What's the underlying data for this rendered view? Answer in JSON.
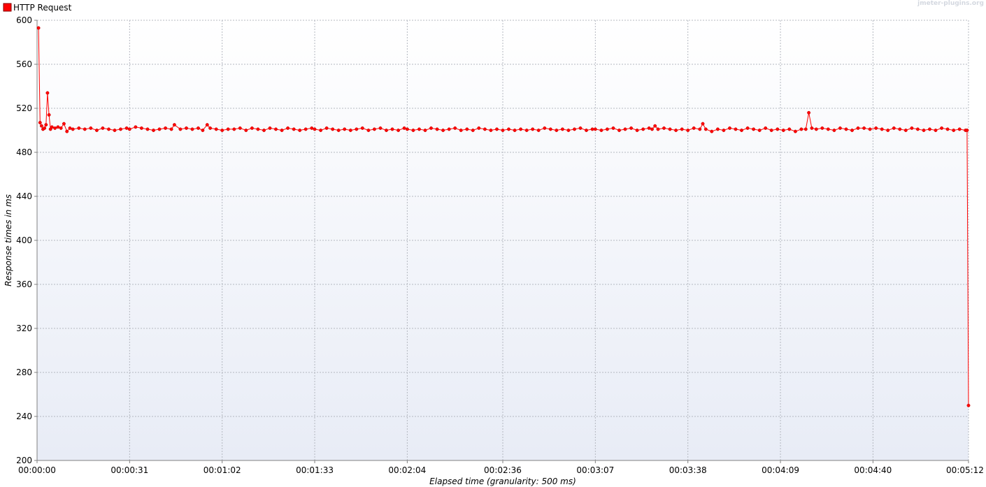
{
  "watermark": "jmeter-plugins.org",
  "chart_data": {
    "type": "line",
    "title": "",
    "xlabel": "Elapsed time (granularity: 500 ms)",
    "ylabel": "Response times in ms",
    "x_unit": "seconds elapsed",
    "xlim": [
      0,
      312
    ],
    "ylim": [
      200,
      600
    ],
    "y_ticks": [
      200,
      240,
      280,
      320,
      360,
      400,
      440,
      480,
      520,
      560,
      600
    ],
    "x_ticks": [
      {
        "value": 0,
        "label": "00:00:00"
      },
      {
        "value": 31,
        "label": "00:00:31"
      },
      {
        "value": 62,
        "label": "00:01:02"
      },
      {
        "value": 93,
        "label": "00:01:33"
      },
      {
        "value": 124,
        "label": "00:02:04"
      },
      {
        "value": 156,
        "label": "00:02:36"
      },
      {
        "value": 187,
        "label": "00:03:07"
      },
      {
        "value": 218,
        "label": "00:03:38"
      },
      {
        "value": 249,
        "label": "00:04:09"
      },
      {
        "value": 280,
        "label": "00:04:40"
      },
      {
        "value": 312,
        "label": "00:05:12"
      }
    ],
    "grid": true,
    "legend_position": "top-left",
    "series": [
      {
        "name": "HTTP Request",
        "color": "#ff0000",
        "points": [
          [
            0.5,
            593
          ],
          [
            1.0,
            507
          ],
          [
            1.5,
            504
          ],
          [
            2.0,
            501
          ],
          [
            2.5,
            502
          ],
          [
            3.0,
            505
          ],
          [
            3.5,
            534
          ],
          [
            4.0,
            514
          ],
          [
            4.5,
            501
          ],
          [
            5.0,
            503
          ],
          [
            6.0,
            502
          ],
          [
            7.0,
            503
          ],
          [
            8.0,
            502
          ],
          [
            9.0,
            506
          ],
          [
            10.0,
            499
          ],
          [
            11.0,
            502
          ],
          [
            12.0,
            501
          ],
          [
            14.0,
            502
          ],
          [
            16.0,
            501
          ],
          [
            18.0,
            502
          ],
          [
            20.0,
            500
          ],
          [
            22.0,
            502
          ],
          [
            24.0,
            501
          ],
          [
            26.0,
            500
          ],
          [
            28.0,
            501
          ],
          [
            30.0,
            502
          ],
          [
            31.0,
            501
          ],
          [
            33.0,
            503
          ],
          [
            35.0,
            502
          ],
          [
            37.0,
            501
          ],
          [
            39.0,
            500
          ],
          [
            41.0,
            501
          ],
          [
            43.0,
            502
          ],
          [
            45.0,
            501
          ],
          [
            46.0,
            505
          ],
          [
            48.0,
            501
          ],
          [
            50.0,
            502
          ],
          [
            52.0,
            501
          ],
          [
            54.0,
            502
          ],
          [
            55.5,
            500
          ],
          [
            57.0,
            505
          ],
          [
            58.0,
            502
          ],
          [
            60.0,
            501
          ],
          [
            62.0,
            500
          ],
          [
            64.0,
            501
          ],
          [
            66.0,
            501
          ],
          [
            68.0,
            502
          ],
          [
            70.0,
            500
          ],
          [
            72.0,
            502
          ],
          [
            74.0,
            501
          ],
          [
            76.0,
            500
          ],
          [
            78.0,
            502
          ],
          [
            80.0,
            501
          ],
          [
            82.0,
            500
          ],
          [
            84.0,
            502
          ],
          [
            86.0,
            501
          ],
          [
            88.0,
            500
          ],
          [
            90.0,
            501
          ],
          [
            92.0,
            502
          ],
          [
            93.0,
            501
          ],
          [
            95.0,
            500
          ],
          [
            97.0,
            502
          ],
          [
            99.0,
            501
          ],
          [
            101.0,
            500
          ],
          [
            103.0,
            501
          ],
          [
            105.0,
            500
          ],
          [
            107.0,
            501
          ],
          [
            109.0,
            502
          ],
          [
            111.0,
            500
          ],
          [
            113.0,
            501
          ],
          [
            115.0,
            502
          ],
          [
            117.0,
            500
          ],
          [
            119.0,
            501
          ],
          [
            121.0,
            500
          ],
          [
            123.0,
            502
          ],
          [
            124.0,
            501
          ],
          [
            126.0,
            500
          ],
          [
            128.0,
            501
          ],
          [
            130.0,
            500
          ],
          [
            132.0,
            502
          ],
          [
            134.0,
            501
          ],
          [
            136.0,
            500
          ],
          [
            138.0,
            501
          ],
          [
            140.0,
            502
          ],
          [
            142.0,
            500
          ],
          [
            144.0,
            501
          ],
          [
            146.0,
            500
          ],
          [
            148.0,
            502
          ],
          [
            150.0,
            501
          ],
          [
            152.0,
            500
          ],
          [
            154.0,
            501
          ],
          [
            156.0,
            500
          ],
          [
            158.0,
            501
          ],
          [
            160.0,
            500
          ],
          [
            162.0,
            501
          ],
          [
            164.0,
            500
          ],
          [
            166.0,
            501
          ],
          [
            168.0,
            500
          ],
          [
            170.0,
            502
          ],
          [
            172.0,
            501
          ],
          [
            174.0,
            500
          ],
          [
            176.0,
            501
          ],
          [
            178.0,
            500
          ],
          [
            180.0,
            501
          ],
          [
            182.0,
            502
          ],
          [
            184.0,
            500
          ],
          [
            186.0,
            501
          ],
          [
            187.0,
            501
          ],
          [
            189.0,
            500
          ],
          [
            191.0,
            501
          ],
          [
            193.0,
            502
          ],
          [
            195.0,
            500
          ],
          [
            197.0,
            501
          ],
          [
            199.0,
            502
          ],
          [
            201.0,
            500
          ],
          [
            203.0,
            501
          ],
          [
            205.0,
            502
          ],
          [
            206.0,
            501
          ],
          [
            207.0,
            504
          ],
          [
            208.0,
            501
          ],
          [
            210.0,
            502
          ],
          [
            212.0,
            501
          ],
          [
            214.0,
            500
          ],
          [
            216.0,
            501
          ],
          [
            218.0,
            500
          ],
          [
            220.0,
            502
          ],
          [
            222.0,
            501
          ],
          [
            223.0,
            506
          ],
          [
            224.0,
            501
          ],
          [
            226.0,
            499
          ],
          [
            228.0,
            501
          ],
          [
            230.0,
            500
          ],
          [
            232.0,
            502
          ],
          [
            234.0,
            501
          ],
          [
            236.0,
            500
          ],
          [
            238.0,
            502
          ],
          [
            240.0,
            501
          ],
          [
            242.0,
            500
          ],
          [
            244.0,
            502
          ],
          [
            246.0,
            500
          ],
          [
            248.0,
            501
          ],
          [
            250.0,
            500
          ],
          [
            252.0,
            501
          ],
          [
            254.0,
            499
          ],
          [
            256.0,
            501
          ],
          [
            257.5,
            501
          ],
          [
            258.5,
            516
          ],
          [
            259.5,
            502
          ],
          [
            261.0,
            501
          ],
          [
            263.0,
            502
          ],
          [
            265.0,
            501
          ],
          [
            267.0,
            500
          ],
          [
            269.0,
            502
          ],
          [
            271.0,
            501
          ],
          [
            273.0,
            500
          ],
          [
            275.0,
            502
          ],
          [
            277.0,
            502
          ],
          [
            279.0,
            501
          ],
          [
            281.0,
            502
          ],
          [
            283.0,
            501
          ],
          [
            285.0,
            500
          ],
          [
            287.0,
            502
          ],
          [
            289.0,
            501
          ],
          [
            291.0,
            500
          ],
          [
            293.0,
            502
          ],
          [
            295.0,
            501
          ],
          [
            297.0,
            500
          ],
          [
            299.0,
            501
          ],
          [
            301.0,
            500
          ],
          [
            303.0,
            502
          ],
          [
            305.0,
            501
          ],
          [
            307.0,
            500
          ],
          [
            309.0,
            501
          ],
          [
            311.0,
            500
          ],
          [
            311.5,
            500
          ],
          [
            312.0,
            250
          ]
        ]
      }
    ]
  }
}
